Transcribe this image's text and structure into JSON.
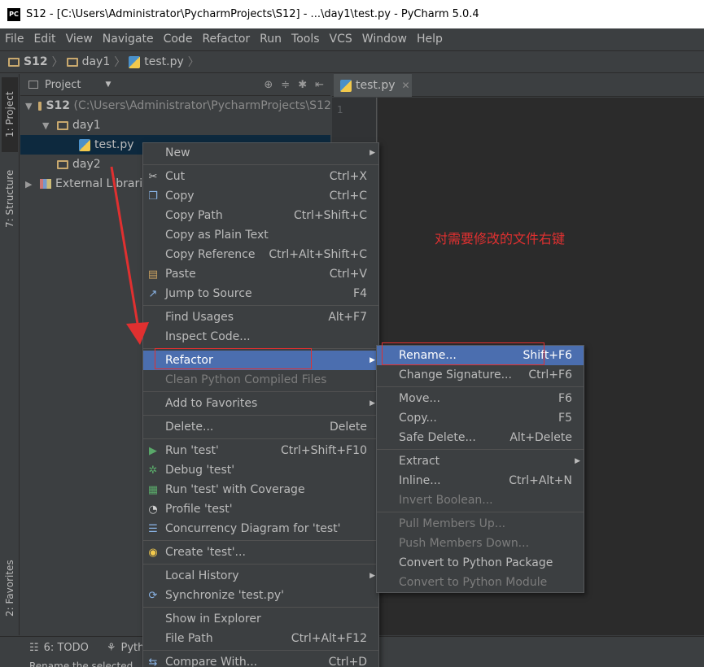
{
  "window": {
    "title": "S12 - [C:\\Users\\Administrator\\PycharmProjects\\S12] - ...\\day1\\test.py - PyCharm 5.0.4",
    "app_badge": "PC"
  },
  "menubar": [
    "File",
    "Edit",
    "View",
    "Navigate",
    "Code",
    "Refactor",
    "Run",
    "Tools",
    "VCS",
    "Window",
    "Help"
  ],
  "navbar": {
    "crumbs": [
      "S12",
      "day1",
      "test.py"
    ]
  },
  "toolstrip": {
    "project": "1: Project",
    "structure": "7: Structure",
    "favorites": "2: Favorites"
  },
  "project_panel": {
    "header": "Project",
    "root_name": "S12",
    "root_path": "(C:\\Users\\Administrator\\PycharmProjects\\S12)",
    "day1": "day1",
    "file": "test.py",
    "day2": "day2",
    "ext": "External Librarie"
  },
  "editor": {
    "tab": "test.py",
    "line1": "1",
    "annotation": "对需要修改的文件右键"
  },
  "context_menu": {
    "new": "New",
    "cut": "Cut",
    "cut_sc": "Ctrl+X",
    "copy": "Copy",
    "copy_sc": "Ctrl+C",
    "copy_path": "Copy Path",
    "copy_path_sc": "Ctrl+Shift+C",
    "copy_plain": "Copy as Plain Text",
    "copy_ref": "Copy Reference",
    "copy_ref_sc": "Ctrl+Alt+Shift+C",
    "paste": "Paste",
    "paste_sc": "Ctrl+V",
    "jump": "Jump to Source",
    "jump_sc": "F4",
    "find": "Find Usages",
    "find_sc": "Alt+F7",
    "inspect": "Inspect Code...",
    "refactor": "Refactor",
    "clean": "Clean Python Compiled Files",
    "favorites": "Add to Favorites",
    "delete": "Delete...",
    "delete_sc": "Delete",
    "run": "Run 'test'",
    "run_sc": "Ctrl+Shift+F10",
    "debug": "Debug 'test'",
    "coverage": "Run 'test' with Coverage",
    "profile": "Profile 'test'",
    "concurrency": "Concurrency Diagram for  'test'",
    "create": "Create 'test'...",
    "history": "Local History",
    "sync": "Synchronize 'test.py'",
    "explorer": "Show in Explorer",
    "filepath": "File Path",
    "filepath_sc": "Ctrl+Alt+F12",
    "compare": "Compare With...",
    "compare_sc": "Ctrl+D"
  },
  "refactor_menu": {
    "rename": "Rename...",
    "rename_sc": "Shift+F6",
    "change_sig": "Change Signature...",
    "change_sig_sc": "Ctrl+F6",
    "move": "Move...",
    "move_sc": "F6",
    "copy": "Copy...",
    "copy_sc": "F5",
    "safe_delete": "Safe Delete...",
    "safe_delete_sc": "Alt+Delete",
    "extract": "Extract",
    "inline": "Inline...",
    "inline_sc": "Ctrl+Alt+N",
    "invert": "Invert Boolean...",
    "pull": "Pull Members Up...",
    "push": "Push Members Down...",
    "to_package": "Convert to Python Package",
    "to_module": "Convert to Python Module"
  },
  "bottom": {
    "todo": "6: TODO",
    "python": "Pyth",
    "status": "Rename the selected"
  },
  "colors": {
    "accent": "#4b6eaf",
    "annotation": "#e03030",
    "bg": "#3c3f41"
  }
}
